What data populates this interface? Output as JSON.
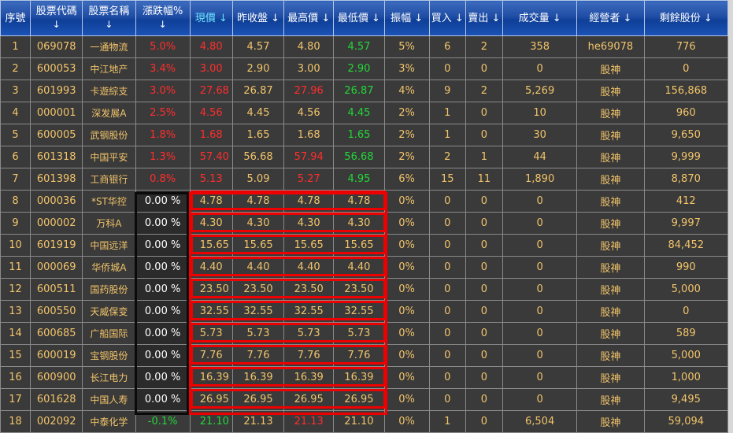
{
  "headers": {
    "idx": "序號",
    "code": "股票代碼",
    "name": "股票名稱",
    "chg": "漲跌幅%",
    "cur": "現價",
    "prev": "昨收盤",
    "high": "最高價",
    "low": "最低價",
    "amp": "振幅",
    "buy": "買入",
    "sell": "賣出",
    "vol": "成交量",
    "trader": "經營者",
    "remain": "剩餘股份",
    "arrow": "↓"
  },
  "colors": {
    "up": "#ff2d2d",
    "down": "#22d639",
    "neutral": "#f2c46a",
    "box_red": "#ee0000",
    "box_black": "#0a0a0a"
  },
  "rows": [
    {
      "idx": "1",
      "code": "069078",
      "name": "一通物流",
      "chg": "5.0%",
      "cur": "4.80",
      "prev": "4.57",
      "high": "4.80",
      "low": "4.57",
      "amp": "5%",
      "buy": "6",
      "sell": "2",
      "vol": "358",
      "trader": "he69078",
      "remain": "776",
      "cur_c": "up",
      "high_c": "",
      "low_c": "dn",
      "chg_c": "up"
    },
    {
      "idx": "2",
      "code": "600053",
      "name": "中江地产",
      "chg": "3.4%",
      "cur": "3.00",
      "prev": "2.90",
      "high": "3.00",
      "low": "2.90",
      "amp": "3%",
      "buy": "0",
      "sell": "0",
      "vol": "0",
      "trader": "股神",
      "remain": "0",
      "cur_c": "up",
      "high_c": "",
      "low_c": "dn",
      "chg_c": "up"
    },
    {
      "idx": "3",
      "code": "601993",
      "name": "卡遊綜支",
      "chg": "3.0%",
      "cur": "27.68",
      "prev": "26.87",
      "high": "27.96",
      "low": "26.87",
      "amp": "4%",
      "buy": "9",
      "sell": "2",
      "vol": "5,269",
      "trader": "股神",
      "remain": "156,868",
      "cur_c": "up",
      "high_c": "up",
      "low_c": "dn",
      "chg_c": "up"
    },
    {
      "idx": "4",
      "code": "000001",
      "name": "深发展A",
      "chg": "2.5%",
      "cur": "4.56",
      "prev": "4.45",
      "high": "4.56",
      "low": "4.45",
      "amp": "2%",
      "buy": "1",
      "sell": "0",
      "vol": "10",
      "trader": "股神",
      "remain": "960",
      "cur_c": "up",
      "high_c": "",
      "low_c": "dn",
      "chg_c": "up"
    },
    {
      "idx": "5",
      "code": "600005",
      "name": "武钢股份",
      "chg": "1.8%",
      "cur": "1.68",
      "prev": "1.65",
      "high": "1.68",
      "low": "1.65",
      "amp": "2%",
      "buy": "1",
      "sell": "0",
      "vol": "30",
      "trader": "股神",
      "remain": "9,650",
      "cur_c": "up",
      "high_c": "",
      "low_c": "dn",
      "chg_c": "up"
    },
    {
      "idx": "6",
      "code": "601318",
      "name": "中国平安",
      "chg": "1.3%",
      "cur": "57.40",
      "prev": "56.68",
      "high": "57.94",
      "low": "56.68",
      "amp": "2%",
      "buy": "2",
      "sell": "1",
      "vol": "44",
      "trader": "股神",
      "remain": "9,999",
      "cur_c": "up",
      "high_c": "up",
      "low_c": "dn",
      "chg_c": "up"
    },
    {
      "idx": "7",
      "code": "601398",
      "name": "工商银行",
      "chg": "0.8%",
      "cur": "5.13",
      "prev": "5.09",
      "high": "5.27",
      "low": "4.95",
      "amp": "6%",
      "buy": "15",
      "sell": "11",
      "vol": "1,890",
      "trader": "股神",
      "remain": "8,870",
      "cur_c": "up",
      "high_c": "up",
      "low_c": "dn",
      "chg_c": "up"
    },
    {
      "idx": "8",
      "code": "000036",
      "name": "*ST华控",
      "chg": "0.00 %",
      "cur": "4.78",
      "prev": "4.78",
      "high": "4.78",
      "low": "4.78",
      "amp": "0%",
      "buy": "0",
      "sell": "0",
      "vol": "0",
      "trader": "股神",
      "remain": "412",
      "cur_c": "",
      "high_c": "",
      "low_c": "",
      "chg_c": "wh"
    },
    {
      "idx": "9",
      "code": "000002",
      "name": "万科A",
      "chg": "0.00 %",
      "cur": "4.30",
      "prev": "4.30",
      "high": "4.30",
      "low": "4.30",
      "amp": "0%",
      "buy": "0",
      "sell": "0",
      "vol": "0",
      "trader": "股神",
      "remain": "9,997",
      "cur_c": "",
      "high_c": "",
      "low_c": "",
      "chg_c": "wh"
    },
    {
      "idx": "10",
      "code": "601919",
      "name": "中国远洋",
      "chg": "0.00 %",
      "cur": "15.65",
      "prev": "15.65",
      "high": "15.65",
      "low": "15.65",
      "amp": "0%",
      "buy": "0",
      "sell": "0",
      "vol": "0",
      "trader": "股神",
      "remain": "84,452",
      "cur_c": "",
      "high_c": "",
      "low_c": "",
      "chg_c": "wh"
    },
    {
      "idx": "11",
      "code": "000069",
      "name": "华侨城A",
      "chg": "0.00 %",
      "cur": "4.40",
      "prev": "4.40",
      "high": "4.40",
      "low": "4.40",
      "amp": "0%",
      "buy": "0",
      "sell": "0",
      "vol": "0",
      "trader": "股神",
      "remain": "990",
      "cur_c": "",
      "high_c": "",
      "low_c": "",
      "chg_c": "wh"
    },
    {
      "idx": "12",
      "code": "600511",
      "name": "国药股份",
      "chg": "0.00 %",
      "cur": "23.50",
      "prev": "23.50",
      "high": "23.50",
      "low": "23.50",
      "amp": "0%",
      "buy": "0",
      "sell": "0",
      "vol": "0",
      "trader": "股神",
      "remain": "5,000",
      "cur_c": "",
      "high_c": "",
      "low_c": "",
      "chg_c": "wh"
    },
    {
      "idx": "13",
      "code": "600550",
      "name": "天威保变",
      "chg": "0.00 %",
      "cur": "32.55",
      "prev": "32.55",
      "high": "32.55",
      "low": "32.55",
      "amp": "0%",
      "buy": "0",
      "sell": "0",
      "vol": "0",
      "trader": "股神",
      "remain": "0",
      "cur_c": "",
      "high_c": "",
      "low_c": "",
      "chg_c": "wh"
    },
    {
      "idx": "14",
      "code": "600685",
      "name": "广船国际",
      "chg": "0.00 %",
      "cur": "5.73",
      "prev": "5.73",
      "high": "5.73",
      "low": "5.73",
      "amp": "0%",
      "buy": "0",
      "sell": "0",
      "vol": "0",
      "trader": "股神",
      "remain": "589",
      "cur_c": "",
      "high_c": "",
      "low_c": "",
      "chg_c": "wh"
    },
    {
      "idx": "15",
      "code": "600019",
      "name": "宝钢股份",
      "chg": "0.00 %",
      "cur": "7.76",
      "prev": "7.76",
      "high": "7.76",
      "low": "7.76",
      "amp": "0%",
      "buy": "0",
      "sell": "0",
      "vol": "0",
      "trader": "股神",
      "remain": "5,000",
      "cur_c": "",
      "high_c": "",
      "low_c": "",
      "chg_c": "wh"
    },
    {
      "idx": "16",
      "code": "600900",
      "name": "长江电力",
      "chg": "0.00 %",
      "cur": "16.39",
      "prev": "16.39",
      "high": "16.39",
      "low": "16.39",
      "amp": "0%",
      "buy": "0",
      "sell": "0",
      "vol": "0",
      "trader": "股神",
      "remain": "1,000",
      "cur_c": "",
      "high_c": "",
      "low_c": "",
      "chg_c": "wh"
    },
    {
      "idx": "17",
      "code": "601628",
      "name": "中国人寿",
      "chg": "0.00 %",
      "cur": "26.95",
      "prev": "26.95",
      "high": "26.95",
      "low": "26.95",
      "amp": "0%",
      "buy": "0",
      "sell": "0",
      "vol": "0",
      "trader": "股神",
      "remain": "9,495",
      "cur_c": "",
      "high_c": "",
      "low_c": "",
      "chg_c": "wh"
    },
    {
      "idx": "18",
      "code": "002092",
      "name": "中泰化学",
      "chg": "-0.1%",
      "cur": "21.10",
      "prev": "21.13",
      "high": "21.13",
      "low": "21.10",
      "amp": "0%",
      "buy": "1",
      "sell": "0",
      "vol": "6,504",
      "trader": "股神",
      "remain": "59,094",
      "cur_c": "dn",
      "high_c": "up",
      "low_c": "",
      "chg_c": "dn"
    }
  ]
}
